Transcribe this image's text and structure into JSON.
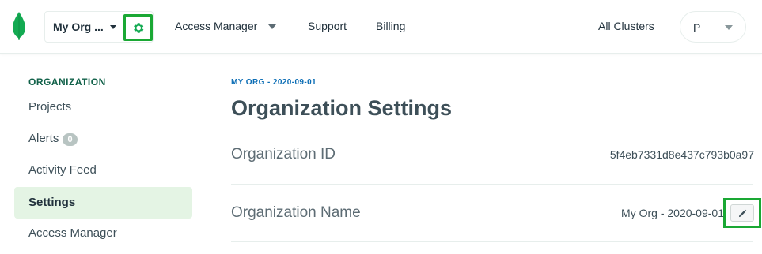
{
  "topbar": {
    "org_name": "My Org ...",
    "nav": {
      "access_manager": "Access Manager",
      "support": "Support",
      "billing": "Billing",
      "all_clusters": "All Clusters"
    },
    "user_initial": "P",
    "icons": {
      "logo": "mongodb-leaf-icon",
      "org_caret": "caret-down-icon",
      "settings": "gear-icon",
      "access_caret": "caret-down-icon",
      "user_caret": "caret-down-icon"
    },
    "accent_color": "#1aa834"
  },
  "sidebar": {
    "heading": "ORGANIZATION",
    "items": [
      {
        "label": "Projects"
      },
      {
        "label": "Alerts",
        "badge": "0"
      },
      {
        "label": "Activity Feed"
      },
      {
        "label": "Settings",
        "active": true
      },
      {
        "label": "Access Manager"
      }
    ],
    "active_bg": "#e4f4e4"
  },
  "main": {
    "breadcrumb": "MY ORG - 2020-09-01",
    "title": "Organization Settings",
    "rows": [
      {
        "label": "Organization ID",
        "value": "5f4eb7331d8e437c793b0a97"
      },
      {
        "label": "Organization Name",
        "value": "My Org - 2020-09-01",
        "action_icon": "pencil-icon"
      }
    ]
  }
}
